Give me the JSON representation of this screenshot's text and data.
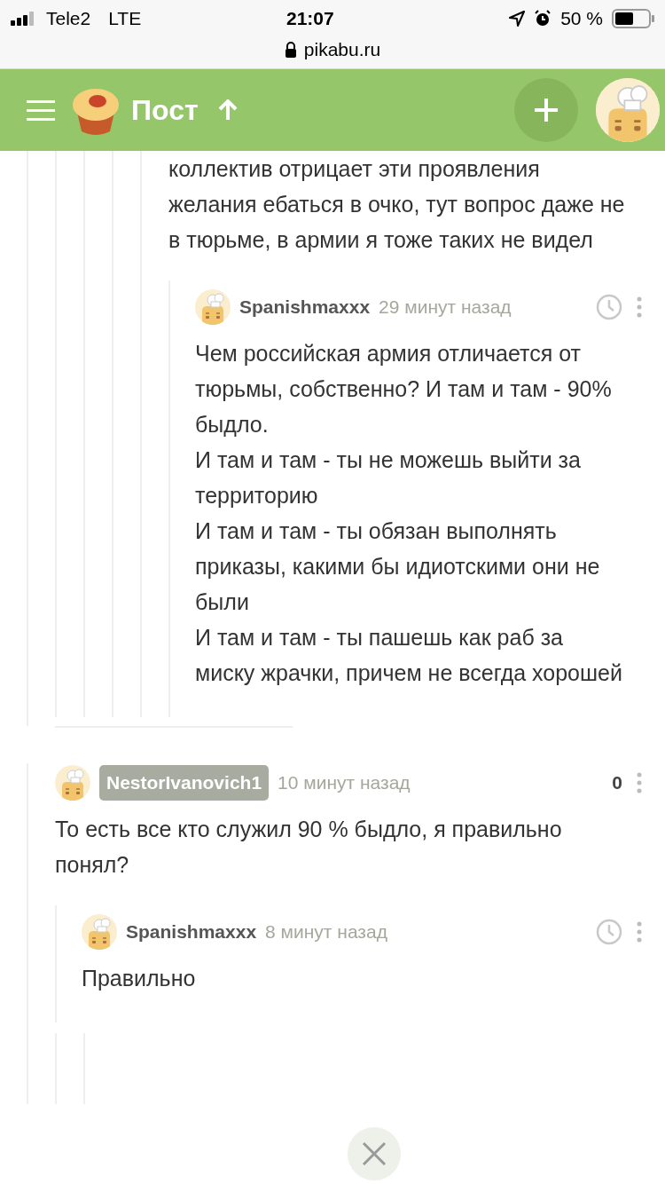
{
  "status_bar": {
    "carrier": "Tele2",
    "network": "LTE",
    "time": "21:07",
    "battery": "50 %"
  },
  "address_bar": {
    "url": "pikabu.ru"
  },
  "header": {
    "title": "Пост"
  },
  "threads": [
    {
      "comment": {
        "partial": true,
        "paragraphs": [
          "коллектив отрицает эти проявления желания ебаться в очко, тут вопрос даже не в тюрьме, в армии я тоже таких не видел"
        ],
        "children": [
          {
            "author": "Spanishmaxxx",
            "author_highlighted": false,
            "time": "29 минут назад",
            "paragraphs": [
              "Чем российская армия отличается от тюрьмы, собственно? И там и там - 90% быдло.",
              "И там и там - ты не можешь выйти за территорию",
              "И там и там - ты обязан выполнять приказы, какими бы идиотскими они не были",
              "И там и там - ты пашешь как раб за миску жрачки, причем не всегда хорошей"
            ]
          }
        ]
      }
    },
    {
      "comment": {
        "author": "NestorIvanovich1",
        "author_highlighted": true,
        "time": "10 минут назад",
        "rating": "0",
        "paragraphs": [
          "То есть все кто служил 90 % быдло, я правильно понял?"
        ],
        "children": [
          {
            "author": "Spanishmaxxx",
            "author_highlighted": false,
            "time": "8 минут назад",
            "paragraphs": [
              "Правильно"
            ]
          }
        ]
      }
    }
  ]
}
